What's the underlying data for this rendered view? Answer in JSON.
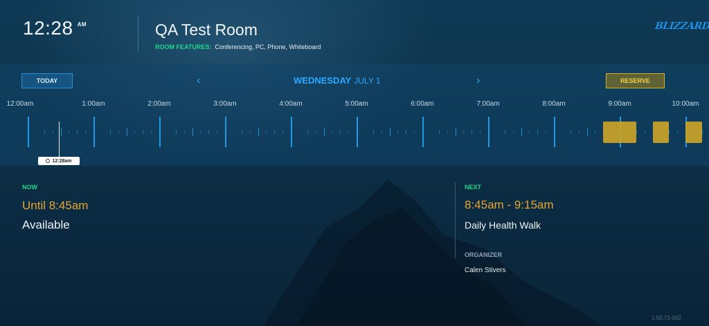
{
  "header": {
    "time": "12:28",
    "ampm": "AM",
    "room_name": "QA Test Room",
    "features_label": "ROOM FEATURES:",
    "features": "Conferencing, PC, Phone, Whiteboard",
    "logo_text": "BLIZZARD"
  },
  "schedule_bar": {
    "today_label": "TODAY",
    "reserve_label": "RESERVE",
    "day": "WEDNESDAY",
    "month_day": "JULY 1",
    "hours": [
      "12:00am",
      "1:00am",
      "2:00am",
      "3:00am",
      "4:00am",
      "5:00am",
      "6:00am",
      "7:00am",
      "8:00am",
      "9:00am",
      "10:00am"
    ],
    "now_marker": "12:28am",
    "booked_slots": [
      {
        "start": "8:45am",
        "end": "9:15am"
      },
      {
        "start": "9:30am",
        "end": "9:45am"
      },
      {
        "start": "10:00am",
        "end": "10:15am"
      }
    ]
  },
  "now": {
    "label": "NOW",
    "until": "Until 8:45am",
    "status": "Available"
  },
  "next": {
    "label": "NEXT",
    "time_range": "8:45am - 9:15am",
    "title": "Daily Health Walk",
    "organizer_label": "ORGANIZER",
    "organizer": "Calen Stivers"
  },
  "footer": {
    "version": "1.50.72-002"
  },
  "colors": {
    "accent_blue": "#2ba8ff",
    "accent_green": "#1fd88a",
    "accent_gold": "#e9a530",
    "booked": "#c9a428"
  }
}
